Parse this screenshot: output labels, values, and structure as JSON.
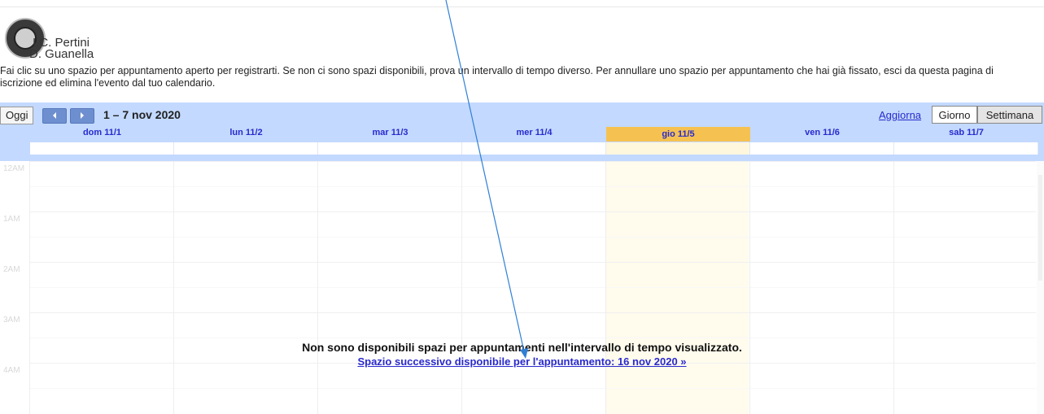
{
  "org": {
    "line1": "I.C. Pertini",
    "line2": "D. Guanella"
  },
  "instructions": "Fai clic su uno spazio per appuntamento aperto per registrarti. Se non ci sono spazi disponibili, prova un intervallo di tempo diverso. Per annullare uno spazio per appuntamento che hai già fissato, esci da questa pagina di iscrizione ed elimina l'evento dal tuo calendario.",
  "toolbar": {
    "today_label": "Oggi",
    "range_label": "1 – 7 nov 2020",
    "refresh_label": "Aggiorna",
    "day_view_label": "Giorno",
    "week_view_label": "Settimana",
    "prev_icon": "chevron-left-icon",
    "next_icon": "chevron-right-icon"
  },
  "days": [
    {
      "label": "dom 11/1",
      "today": false
    },
    {
      "label": "lun 11/2",
      "today": false
    },
    {
      "label": "mar 11/3",
      "today": false
    },
    {
      "label": "mer 11/4",
      "today": false
    },
    {
      "label": "gio 11/5",
      "today": true
    },
    {
      "label": "ven 11/6",
      "today": false
    },
    {
      "label": "sab 11/7",
      "today": false
    }
  ],
  "hours": [
    "12AM",
    "1AM",
    "2AM",
    "3AM",
    "4AM"
  ],
  "empty_message": "Non sono disponibili spazi per appuntamenti nell'intervallo di tempo visualizzato.",
  "next_slot_link": "Spazio successivo disponibile per l'appuntamento: 16 nov 2020 »",
  "colors": {
    "header_bg": "#c3d9ff",
    "today_header": "#f5c252",
    "today_column": "#fffbed",
    "link": "#2a2acc",
    "annotation_arrow": "#2f7fd6"
  }
}
